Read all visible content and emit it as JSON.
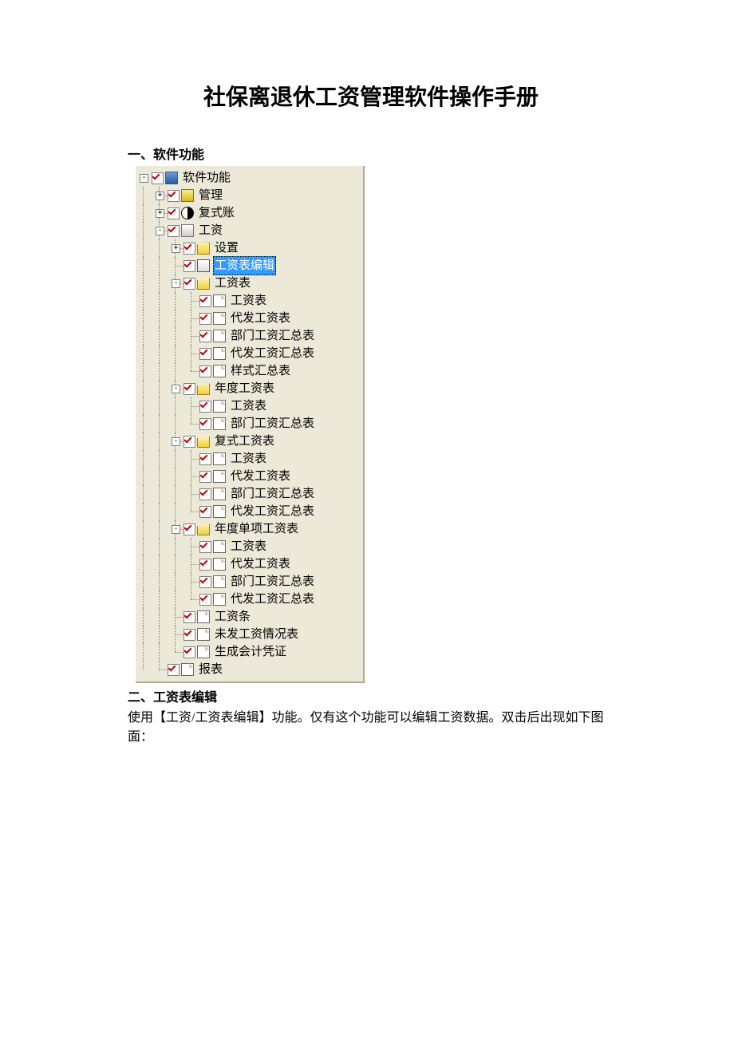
{
  "title": "社保离退休工资管理软件操作手册",
  "section1": "一、软件功能",
  "section2": "二、工资表编辑",
  "para2": "使用【工资/工资表编辑】功能。仅有这个功能可以编辑工资数据。双击后出现如下图面：",
  "tree": {
    "root": "软件功能",
    "mgmt": "管理",
    "fushi": "复式账",
    "salary": "工资",
    "settings": "设置",
    "edit": "工资表编辑",
    "sheet": "工资表",
    "sheet_c1": "工资表",
    "sheet_c2": "代发工资表",
    "sheet_c3": "部门工资汇总表",
    "sheet_c4": "代发工资汇总表",
    "sheet_c5": "样式汇总表",
    "annual": "年度工资表",
    "annual_c1": "工资表",
    "annual_c2": "部门工资汇总表",
    "fushi_sheet": "复式工资表",
    "fushi_c1": "工资表",
    "fushi_c2": "代发工资表",
    "fushi_c3": "部门工资汇总表",
    "fushi_c4": "代发工资汇总表",
    "single": "年度单项工资表",
    "single_c1": "工资表",
    "single_c2": "代发工资表",
    "single_c3": "部门工资汇总表",
    "single_c4": "代发工资汇总表",
    "slip": "工资条",
    "unpaid": "未发工资情况表",
    "voucher": "生成会计凭证",
    "report": "报表"
  }
}
